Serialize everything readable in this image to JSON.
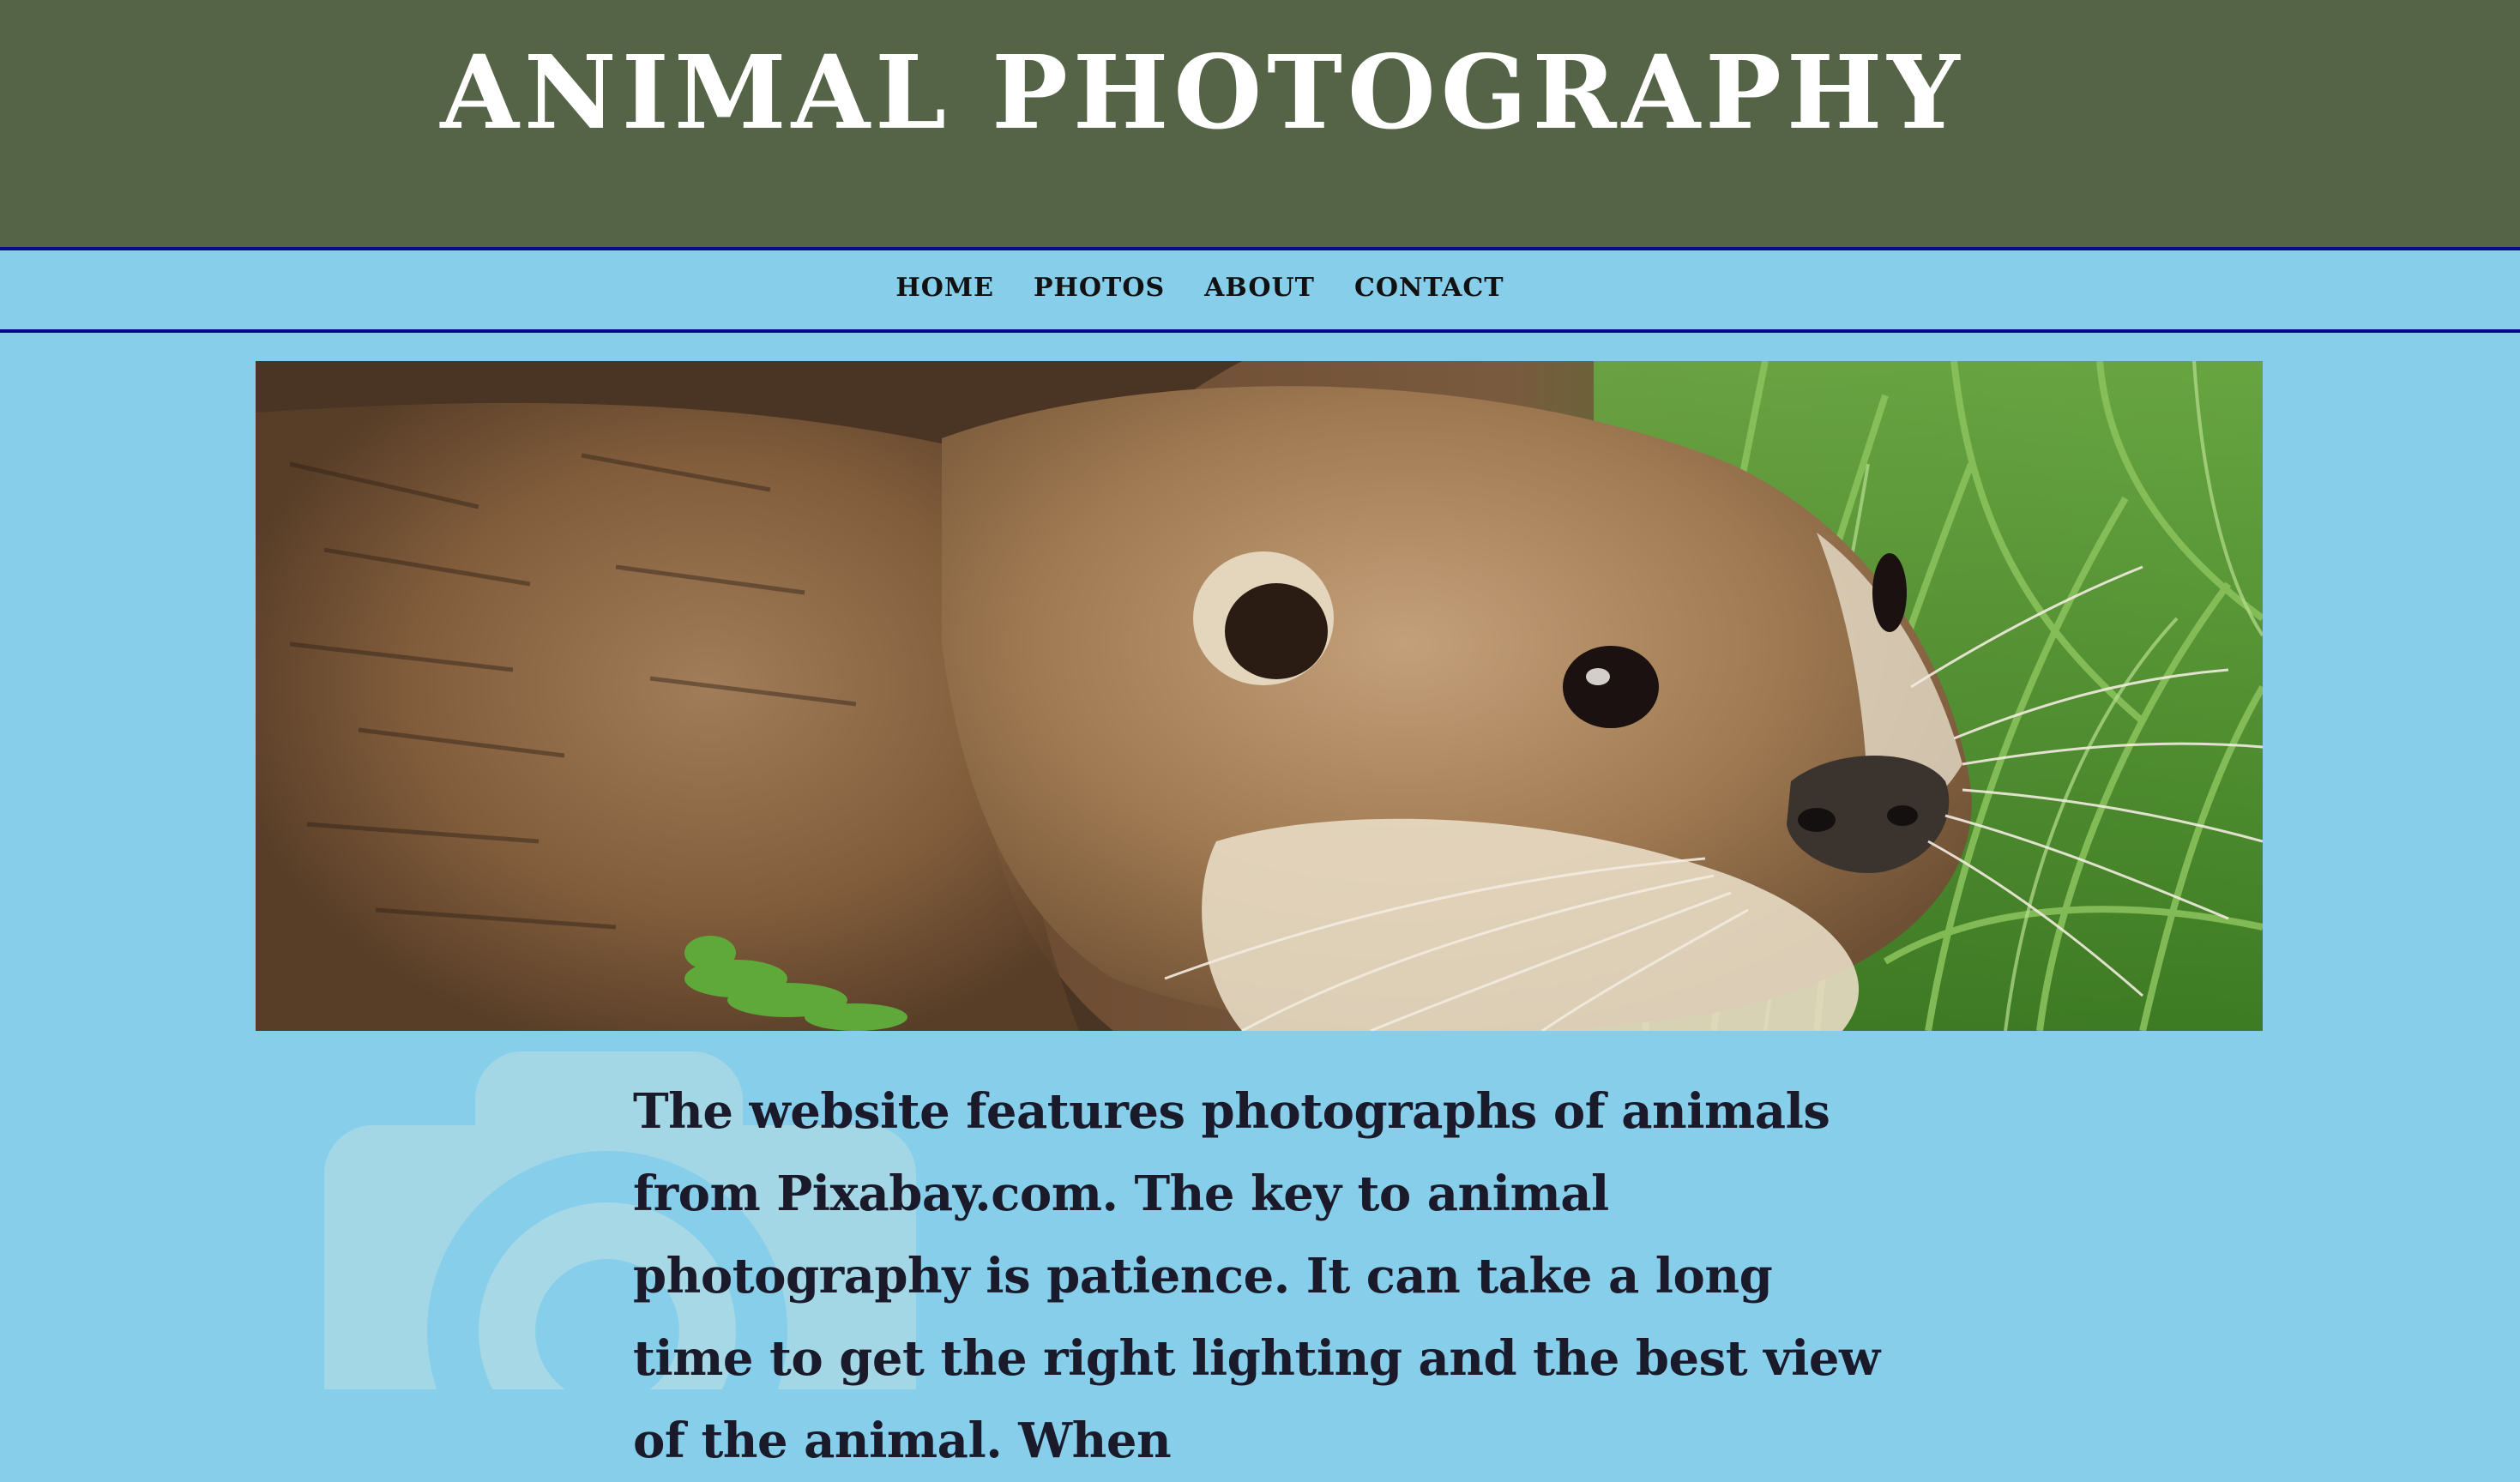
{
  "site": {
    "title": "ANIMAL PHOTOGRAPHY"
  },
  "nav": {
    "items": [
      {
        "label": "HOME"
      },
      {
        "label": "PHOTOS"
      },
      {
        "label": "ABOUT"
      },
      {
        "label": "CONTACT"
      }
    ]
  },
  "hero": {
    "icon": "otter-photo",
    "subject": "otter"
  },
  "main": {
    "icon": "camera-icon",
    "intro_text": "The website features photographs of animals from Pixabay.com. The key to animal photography is patience. It can take a long time to get the right lighting and the best view of the animal. When"
  },
  "colors": {
    "header_bg": "#556346",
    "page_bg": "#87ceeb",
    "nav_border": "#0a0a8c",
    "title_text": "#ffffff"
  }
}
